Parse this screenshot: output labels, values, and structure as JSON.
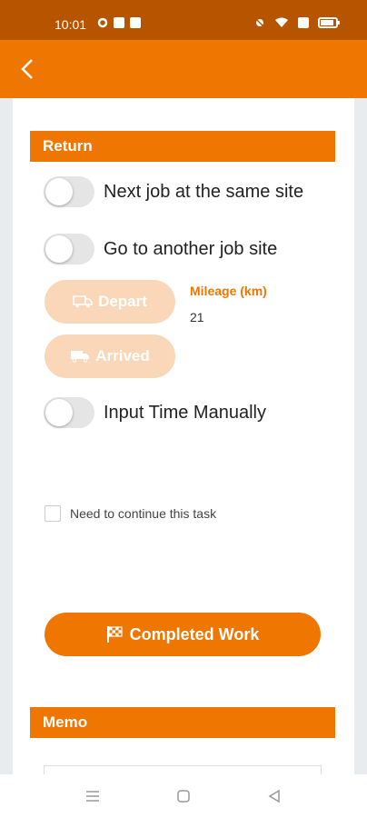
{
  "status_bar": {
    "time": "10:01"
  },
  "app_bar": {
    "back_icon": "chevron-left-icon"
  },
  "return_section": {
    "header": "Return",
    "toggles": [
      {
        "label": "Next job at the same site",
        "on": false
      },
      {
        "label": "Go to another job site",
        "on": false
      }
    ],
    "depart_label": "Depart",
    "arrived_label": "Arrived",
    "mileage_label": "Mileage (km)",
    "mileage_value": "21",
    "manual_time_label": "Input Time Manually",
    "continue_label": "Need to continue this task",
    "continue_checked": false,
    "completed_label": "Completed Work"
  },
  "memo_section": {
    "header": "Memo"
  },
  "colors": {
    "primary": "#ef7600",
    "status_bar": "#b75400",
    "disabled_button": "#fad7b8"
  }
}
